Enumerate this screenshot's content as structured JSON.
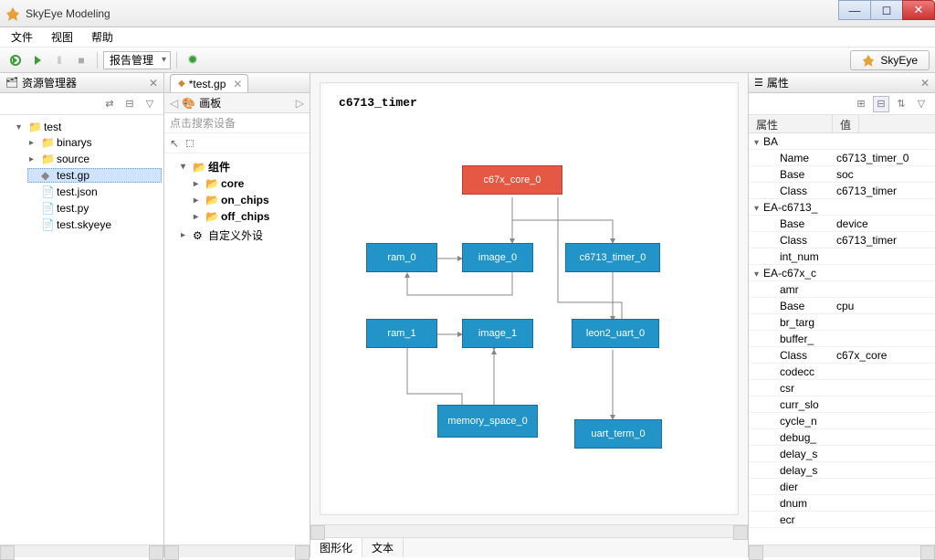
{
  "window": {
    "title": "SkyEye Modeling"
  },
  "menu": {
    "file": "文件",
    "view": "视图",
    "help": "帮助"
  },
  "toolbar": {
    "report_combo": "报告管理",
    "brand_btn": "SkyEye"
  },
  "explorer": {
    "title": "资源管理器",
    "root": "test",
    "items": [
      "binarys",
      "source",
      "test.gp",
      "test.json",
      "test.py",
      "test.skyeye"
    ],
    "selected": 2
  },
  "palette": {
    "tab": "*test.gp",
    "board": "画板",
    "search_placeholder": "点击搜索设备",
    "groups": {
      "components": "组件",
      "core": "core",
      "on_chips": "on_chips",
      "off_chips": "off_chips",
      "custom": "自定义外设"
    }
  },
  "canvas": {
    "title": "c6713_timer",
    "nodes": {
      "core": "c67x_core_0",
      "ram0": "ram_0",
      "image0": "image_0",
      "timer": "c6713_timer_0",
      "ram1": "ram_1",
      "image1": "image_1",
      "uart": "leon2_uart_0",
      "mem": "memory_space_0",
      "term": "uart_term_0"
    },
    "footer": {
      "graph": "图形化",
      "text": "文本"
    }
  },
  "properties": {
    "title": "属性",
    "col_key": "属性",
    "col_val": "值",
    "rows": [
      {
        "k": "BA",
        "v": "",
        "grp": 1,
        "ind": 0
      },
      {
        "k": "Name",
        "v": "c6713_timer_0",
        "ind": 1
      },
      {
        "k": "Base",
        "v": "soc",
        "ind": 1
      },
      {
        "k": "Class",
        "v": "c6713_timer",
        "ind": 1
      },
      {
        "k": "EA-c6713_",
        "v": "",
        "grp": 1,
        "ind": 0
      },
      {
        "k": "Base",
        "v": "device",
        "ind": 1
      },
      {
        "k": "Class",
        "v": "c6713_timer",
        "ind": 1
      },
      {
        "k": "int_num",
        "v": "",
        "ind": 1
      },
      {
        "k": "EA-c67x_c",
        "v": "",
        "grp": 1,
        "ind": 0
      },
      {
        "k": "amr",
        "v": "",
        "ind": 1
      },
      {
        "k": "Base",
        "v": "cpu",
        "ind": 1
      },
      {
        "k": "br_targ",
        "v": "",
        "ind": 1
      },
      {
        "k": "buffer_",
        "v": "",
        "ind": 1
      },
      {
        "k": "Class",
        "v": "c67x_core",
        "ind": 1
      },
      {
        "k": "codecc",
        "v": "",
        "ind": 1
      },
      {
        "k": "csr",
        "v": "",
        "ind": 1
      },
      {
        "k": "curr_slo",
        "v": "",
        "ind": 1
      },
      {
        "k": "cycle_n",
        "v": "",
        "ind": 1
      },
      {
        "k": "debug_",
        "v": "",
        "ind": 1
      },
      {
        "k": "delay_s",
        "v": "",
        "ind": 1
      },
      {
        "k": "delay_s",
        "v": "",
        "ind": 1
      },
      {
        "k": "dier",
        "v": "",
        "ind": 1
      },
      {
        "k": "dnum",
        "v": "",
        "ind": 1
      },
      {
        "k": "ecr",
        "v": "",
        "ind": 1
      }
    ]
  }
}
